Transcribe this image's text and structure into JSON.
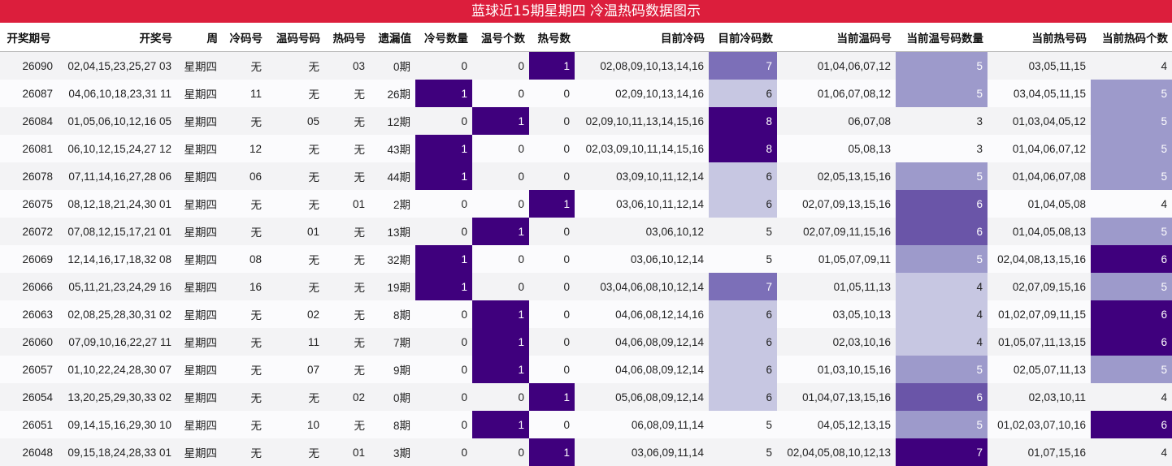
{
  "title": "蓝球近15期星期四 冷温热码数据图示",
  "colors": {
    "title_bg": "#dc1e3c",
    "heat_1": "#c7c7e2",
    "heat_2": "#9d9acb",
    "heat_3": "#7c6fb8",
    "heat_4": "#6a55a8",
    "heat_5": "#3f007d"
  },
  "columns": [
    "开奖期号",
    "开奖号",
    "周",
    "冷码号",
    "温码号码",
    "热码号",
    "遗漏值",
    "冷号数量",
    "温号个数",
    "热号数",
    "目前冷码",
    "目前冷码数",
    "当前温码号",
    "当前温号码数量",
    "当前热号码",
    "当前热码个数"
  ],
  "rows": [
    {
      "issue": "26090",
      "numbers": "02,04,15,23,25,27 03",
      "week": "星期四",
      "cold": "无",
      "warm": "无",
      "hot": "03",
      "omission": "0期",
      "cold_count": "0",
      "warm_count": "0",
      "hot_count": "1",
      "cur_cold": "02,08,09,10,13,14,16",
      "cur_cold_count": "7",
      "cur_warm": "01,04,06,07,12",
      "cur_warm_count": "5",
      "cur_hot": "03,05,11,15",
      "cur_hot_count": "4"
    },
    {
      "issue": "26087",
      "numbers": "04,06,10,18,23,31 11",
      "week": "星期四",
      "cold": "11",
      "warm": "无",
      "hot": "无",
      "omission": "26期",
      "cold_count": "1",
      "warm_count": "0",
      "hot_count": "0",
      "cur_cold": "02,09,10,13,14,16",
      "cur_cold_count": "6",
      "cur_warm": "01,06,07,08,12",
      "cur_warm_count": "5",
      "cur_hot": "03,04,05,11,15",
      "cur_hot_count": "5"
    },
    {
      "issue": "26084",
      "numbers": "01,05,06,10,12,16 05",
      "week": "星期四",
      "cold": "无",
      "warm": "05",
      "hot": "无",
      "omission": "12期",
      "cold_count": "0",
      "warm_count": "1",
      "hot_count": "0",
      "cur_cold": "02,09,10,11,13,14,15,16",
      "cur_cold_count": "8",
      "cur_warm": "06,07,08",
      "cur_warm_count": "3",
      "cur_hot": "01,03,04,05,12",
      "cur_hot_count": "5"
    },
    {
      "issue": "26081",
      "numbers": "06,10,12,15,24,27 12",
      "week": "星期四",
      "cold": "12",
      "warm": "无",
      "hot": "无",
      "omission": "43期",
      "cold_count": "1",
      "warm_count": "0",
      "hot_count": "0",
      "cur_cold": "02,03,09,10,11,14,15,16",
      "cur_cold_count": "8",
      "cur_warm": "05,08,13",
      "cur_warm_count": "3",
      "cur_hot": "01,04,06,07,12",
      "cur_hot_count": "5"
    },
    {
      "issue": "26078",
      "numbers": "07,11,14,16,27,28 06",
      "week": "星期四",
      "cold": "06",
      "warm": "无",
      "hot": "无",
      "omission": "44期",
      "cold_count": "1",
      "warm_count": "0",
      "hot_count": "0",
      "cur_cold": "03,09,10,11,12,14",
      "cur_cold_count": "6",
      "cur_warm": "02,05,13,15,16",
      "cur_warm_count": "5",
      "cur_hot": "01,04,06,07,08",
      "cur_hot_count": "5"
    },
    {
      "issue": "26075",
      "numbers": "08,12,18,21,24,30 01",
      "week": "星期四",
      "cold": "无",
      "warm": "无",
      "hot": "01",
      "omission": "2期",
      "cold_count": "0",
      "warm_count": "0",
      "hot_count": "1",
      "cur_cold": "03,06,10,11,12,14",
      "cur_cold_count": "6",
      "cur_warm": "02,07,09,13,15,16",
      "cur_warm_count": "6",
      "cur_hot": "01,04,05,08",
      "cur_hot_count": "4"
    },
    {
      "issue": "26072",
      "numbers": "07,08,12,15,17,21 01",
      "week": "星期四",
      "cold": "无",
      "warm": "01",
      "hot": "无",
      "omission": "13期",
      "cold_count": "0",
      "warm_count": "1",
      "hot_count": "0",
      "cur_cold": "03,06,10,12",
      "cur_cold_count": "5",
      "cur_warm": "02,07,09,11,15,16",
      "cur_warm_count": "6",
      "cur_hot": "01,04,05,08,13",
      "cur_hot_count": "5"
    },
    {
      "issue": "26069",
      "numbers": "12,14,16,17,18,32 08",
      "week": "星期四",
      "cold": "08",
      "warm": "无",
      "hot": "无",
      "omission": "32期",
      "cold_count": "1",
      "warm_count": "0",
      "hot_count": "0",
      "cur_cold": "03,06,10,12,14",
      "cur_cold_count": "5",
      "cur_warm": "01,05,07,09,11",
      "cur_warm_count": "5",
      "cur_hot": "02,04,08,13,15,16",
      "cur_hot_count": "6"
    },
    {
      "issue": "26066",
      "numbers": "05,11,21,23,24,29 16",
      "week": "星期四",
      "cold": "16",
      "warm": "无",
      "hot": "无",
      "omission": "19期",
      "cold_count": "1",
      "warm_count": "0",
      "hot_count": "0",
      "cur_cold": "03,04,06,08,10,12,14",
      "cur_cold_count": "7",
      "cur_warm": "01,05,11,13",
      "cur_warm_count": "4",
      "cur_hot": "02,07,09,15,16",
      "cur_hot_count": "5"
    },
    {
      "issue": "26063",
      "numbers": "02,08,25,28,30,31 02",
      "week": "星期四",
      "cold": "无",
      "warm": "02",
      "hot": "无",
      "omission": "8期",
      "cold_count": "0",
      "warm_count": "1",
      "hot_count": "0",
      "cur_cold": "04,06,08,12,14,16",
      "cur_cold_count": "6",
      "cur_warm": "03,05,10,13",
      "cur_warm_count": "4",
      "cur_hot": "01,02,07,09,11,15",
      "cur_hot_count": "6"
    },
    {
      "issue": "26060",
      "numbers": "07,09,10,16,22,27 11",
      "week": "星期四",
      "cold": "无",
      "warm": "11",
      "hot": "无",
      "omission": "7期",
      "cold_count": "0",
      "warm_count": "1",
      "hot_count": "0",
      "cur_cold": "04,06,08,09,12,14",
      "cur_cold_count": "6",
      "cur_warm": "02,03,10,16",
      "cur_warm_count": "4",
      "cur_hot": "01,05,07,11,13,15",
      "cur_hot_count": "6"
    },
    {
      "issue": "26057",
      "numbers": "01,10,22,24,28,30 07",
      "week": "星期四",
      "cold": "无",
      "warm": "07",
      "hot": "无",
      "omission": "9期",
      "cold_count": "0",
      "warm_count": "1",
      "hot_count": "0",
      "cur_cold": "04,06,08,09,12,14",
      "cur_cold_count": "6",
      "cur_warm": "01,03,10,15,16",
      "cur_warm_count": "5",
      "cur_hot": "02,05,07,11,13",
      "cur_hot_count": "5"
    },
    {
      "issue": "26054",
      "numbers": "13,20,25,29,30,33 02",
      "week": "星期四",
      "cold": "无",
      "warm": "无",
      "hot": "02",
      "omission": "0期",
      "cold_count": "0",
      "warm_count": "0",
      "hot_count": "1",
      "cur_cold": "05,06,08,09,12,14",
      "cur_cold_count": "6",
      "cur_warm": "01,04,07,13,15,16",
      "cur_warm_count": "6",
      "cur_hot": "02,03,10,11",
      "cur_hot_count": "4"
    },
    {
      "issue": "26051",
      "numbers": "09,14,15,16,29,30 10",
      "week": "星期四",
      "cold": "无",
      "warm": "10",
      "hot": "无",
      "omission": "8期",
      "cold_count": "0",
      "warm_count": "1",
      "hot_count": "0",
      "cur_cold": "06,08,09,11,14",
      "cur_cold_count": "5",
      "cur_warm": "04,05,12,13,15",
      "cur_warm_count": "5",
      "cur_hot": "01,02,03,07,10,16",
      "cur_hot_count": "6"
    },
    {
      "issue": "26048",
      "numbers": "09,15,18,24,28,33 01",
      "week": "星期四",
      "cold": "无",
      "warm": "无",
      "hot": "01",
      "omission": "3期",
      "cold_count": "0",
      "warm_count": "0",
      "hot_count": "1",
      "cur_cold": "03,06,09,11,14",
      "cur_cold_count": "5",
      "cur_warm": "02,04,05,08,10,12,13",
      "cur_warm_count": "7",
      "cur_hot": "01,07,15,16",
      "cur_hot_count": "4"
    }
  ]
}
